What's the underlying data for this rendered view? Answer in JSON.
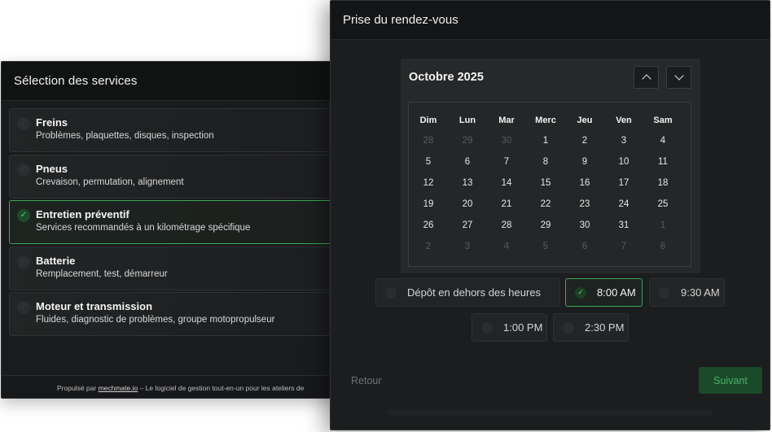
{
  "services": {
    "title": "Sélection des services",
    "items": [
      {
        "name": "Freins",
        "desc": "Problèmes, plaquettes, disques, inspection",
        "selected": false
      },
      {
        "name": "Pneus",
        "desc": "Crevaison, permutation, alignement",
        "selected": false
      },
      {
        "name": "Entretien préventif",
        "desc": "Services recommandés à un kilométrage spécifique",
        "selected": true
      },
      {
        "name": "Batterie",
        "desc": "Remplacement, test, démarreur",
        "selected": false
      },
      {
        "name": "Moteur et transmission",
        "desc": "Fluides, diagnostic de problèmes, groupe motopropulseur",
        "selected": false
      }
    ],
    "footer": {
      "prefix": "Propulsé par ",
      "link": "mechmate.io",
      "suffix": " – Le logiciel de gestion tout-en-un pour les ateliers de"
    }
  },
  "appointment": {
    "title": "Prise du rendez-vous",
    "calendar": {
      "month": "Octobre 2025",
      "weekdays": [
        "Dim",
        "Lun",
        "Mar",
        "Merc",
        "Jeu",
        "Ven",
        "Sam"
      ],
      "weeks": [
        [
          {
            "d": "28",
            "m": true
          },
          {
            "d": "29",
            "m": true
          },
          {
            "d": "30",
            "m": true
          },
          {
            "d": "1",
            "m": false
          },
          {
            "d": "2",
            "m": false
          },
          {
            "d": "3",
            "m": false
          },
          {
            "d": "4",
            "m": false
          }
        ],
        [
          {
            "d": "5",
            "m": false
          },
          {
            "d": "6",
            "m": false
          },
          {
            "d": "7",
            "m": false
          },
          {
            "d": "8",
            "m": false
          },
          {
            "d": "9",
            "m": false
          },
          {
            "d": "10",
            "m": false
          },
          {
            "d": "11",
            "m": false
          }
        ],
        [
          {
            "d": "12",
            "m": false
          },
          {
            "d": "13",
            "m": false
          },
          {
            "d": "14",
            "m": false
          },
          {
            "d": "15",
            "m": false
          },
          {
            "d": "16",
            "m": false
          },
          {
            "d": "17",
            "m": false
          },
          {
            "d": "18",
            "m": false
          }
        ],
        [
          {
            "d": "19",
            "m": false
          },
          {
            "d": "20",
            "m": false
          },
          {
            "d": "21",
            "m": false
          },
          {
            "d": "22",
            "m": false
          },
          {
            "d": "23",
            "m": false
          },
          {
            "d": "24",
            "m": false
          },
          {
            "d": "25",
            "m": false
          }
        ],
        [
          {
            "d": "26",
            "m": false
          },
          {
            "d": "27",
            "m": false
          },
          {
            "d": "28",
            "m": false
          },
          {
            "d": "29",
            "m": false
          },
          {
            "d": "30",
            "m": false
          },
          {
            "d": "31",
            "m": false
          },
          {
            "d": "1",
            "m": true
          }
        ],
        [
          {
            "d": "2",
            "m": true
          },
          {
            "d": "3",
            "m": true
          },
          {
            "d": "4",
            "m": true
          },
          {
            "d": "5",
            "m": true
          },
          {
            "d": "6",
            "m": true
          },
          {
            "d": "7",
            "m": true
          },
          {
            "d": "8",
            "m": true
          }
        ]
      ]
    },
    "slots": [
      {
        "label": "Dépôt en dehors des heures",
        "selected": false
      },
      {
        "label": "8:00 AM",
        "selected": true
      },
      {
        "label": "9:30 AM",
        "selected": false
      },
      {
        "label": "1:00 PM",
        "selected": false
      },
      {
        "label": "2:30 PM",
        "selected": false
      }
    ],
    "back_label": "Retour",
    "next_label": "Suivant"
  },
  "colors": {
    "accent_green": "#3ea85a",
    "panel_bg": "#1a1b1c",
    "header_bg": "#111212"
  }
}
